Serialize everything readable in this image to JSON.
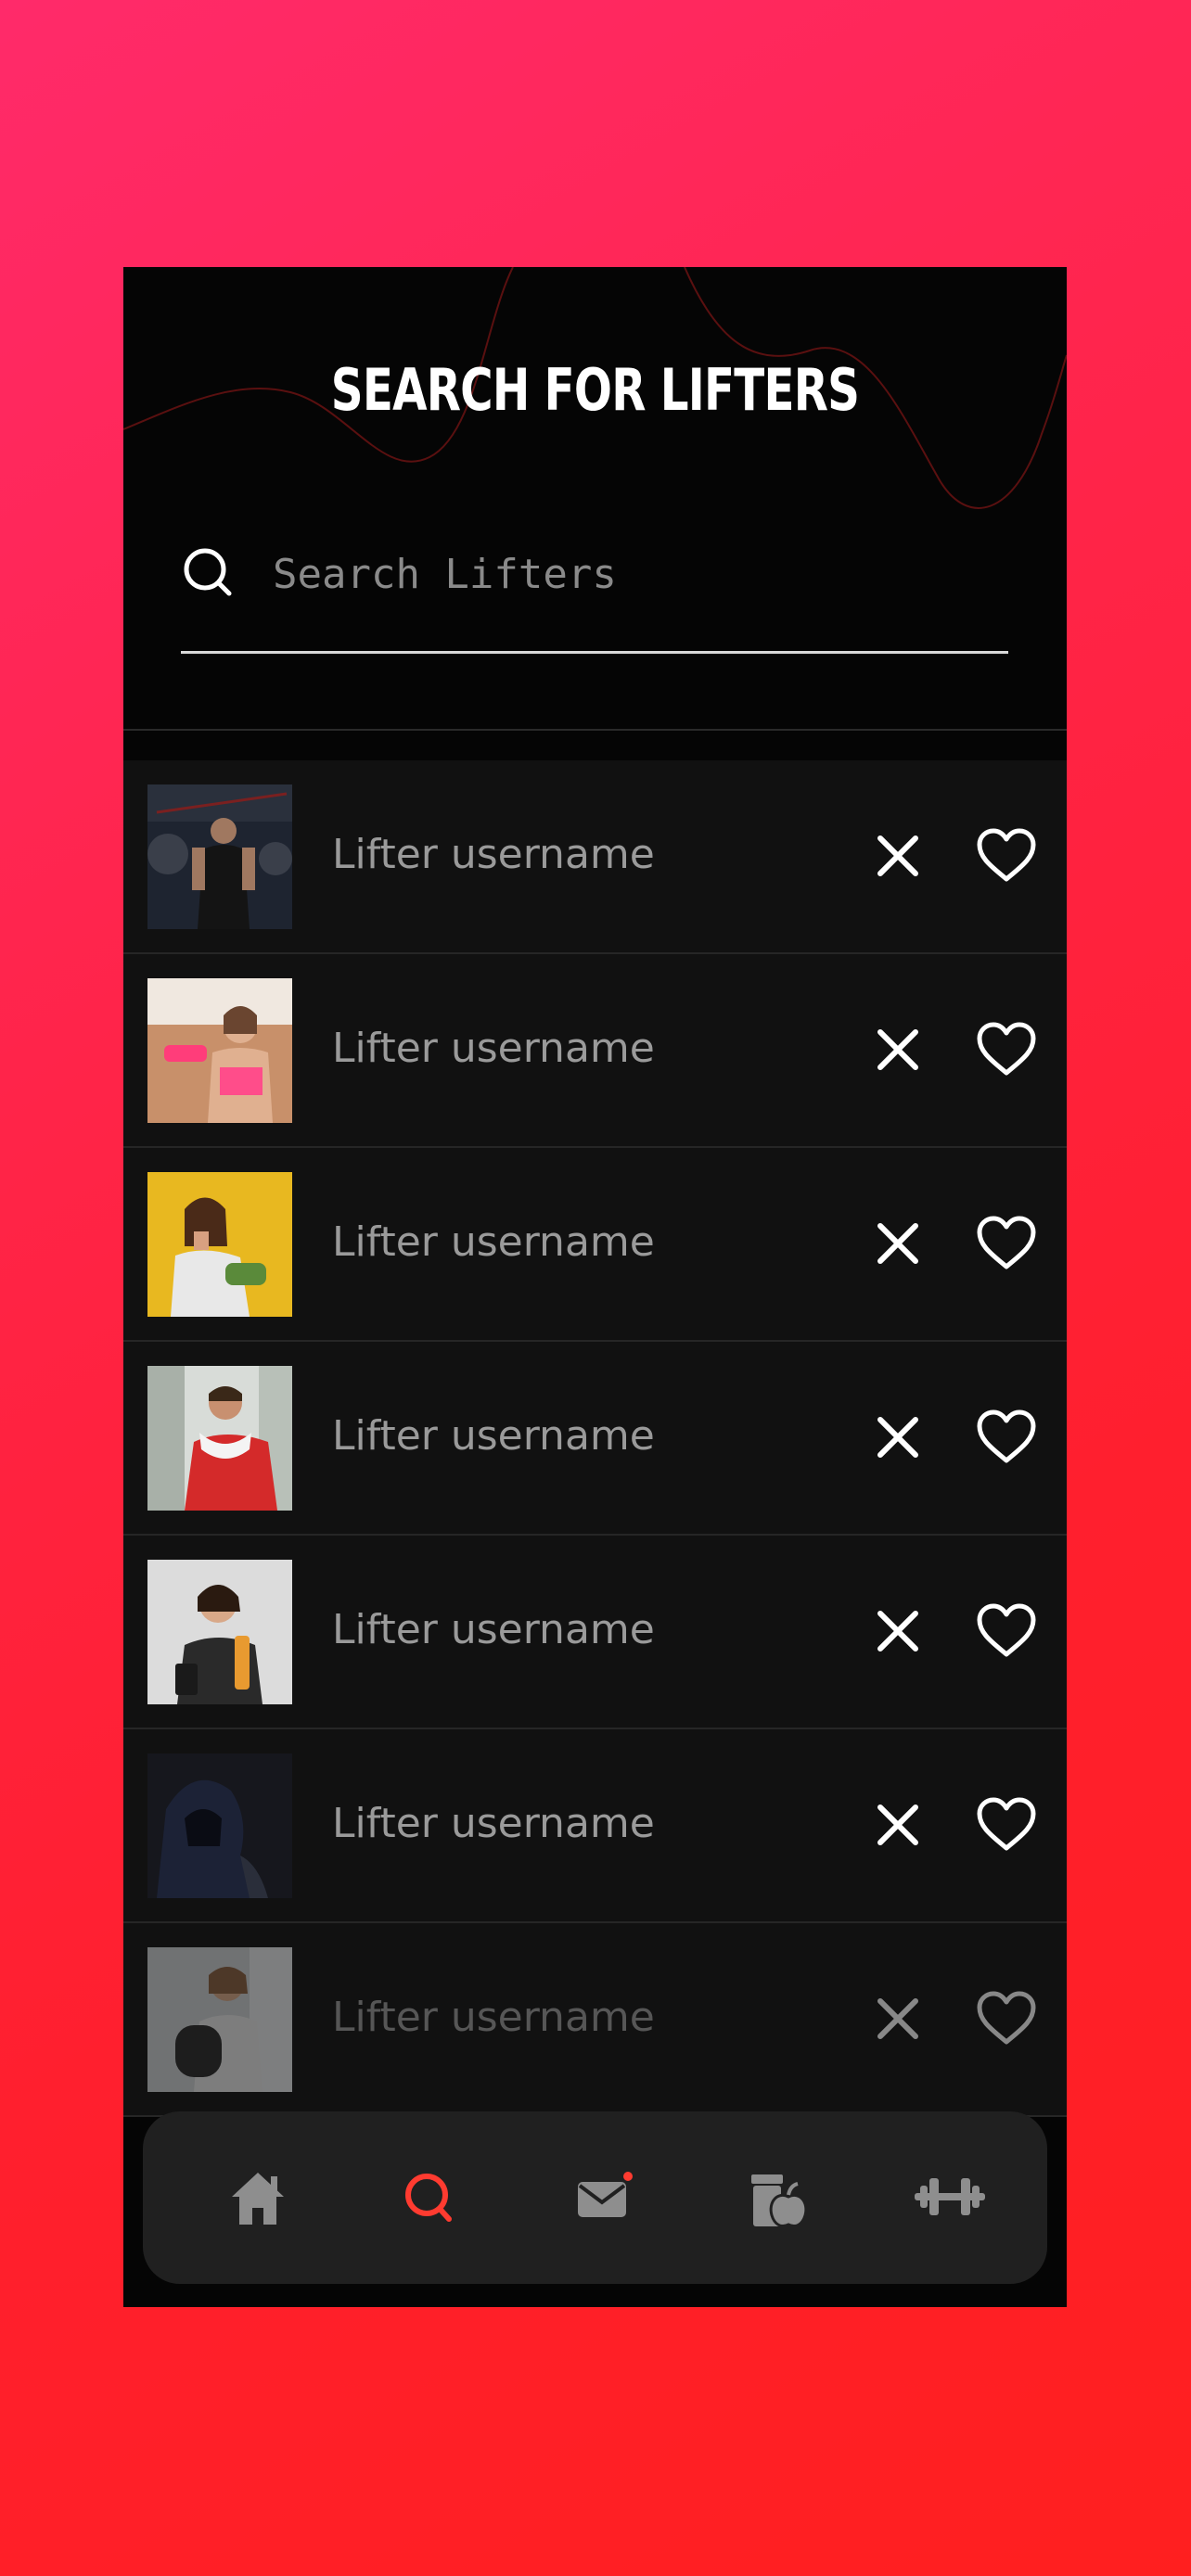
{
  "header": {
    "title": "SEARCH FOR LIFTERS"
  },
  "search": {
    "placeholder": "Search Lifters",
    "value": ""
  },
  "lifters": [
    {
      "username": "Lifter username",
      "photo": "man-training-gym"
    },
    {
      "username": "Lifter username",
      "photo": "woman-pink-dumbbell"
    },
    {
      "username": "Lifter username",
      "photo": "woman-eating-salad"
    },
    {
      "username": "Lifter username",
      "photo": "man-with-towel"
    },
    {
      "username": "Lifter username",
      "photo": "woman-with-bottle"
    },
    {
      "username": "Lifter username",
      "photo": "man-in-hood"
    },
    {
      "username": "Lifter username",
      "photo": "woman-with-mat"
    }
  ],
  "tabbar": {
    "items": [
      {
        "name": "home",
        "icon": "home-icon",
        "active": false
      },
      {
        "name": "search",
        "icon": "search-icon",
        "active": true
      },
      {
        "name": "messages",
        "icon": "mail-icon",
        "active": false,
        "badge": true
      },
      {
        "name": "nutrition",
        "icon": "nutrition-icon",
        "active": false
      },
      {
        "name": "workouts",
        "icon": "dumbbell-icon",
        "active": false
      }
    ]
  },
  "colors": {
    "accent": "#ff3b30",
    "background": "#050505",
    "row_background": "#111111",
    "text_muted": "#9a9a9a",
    "tab_inactive": "#8e8e8e"
  }
}
